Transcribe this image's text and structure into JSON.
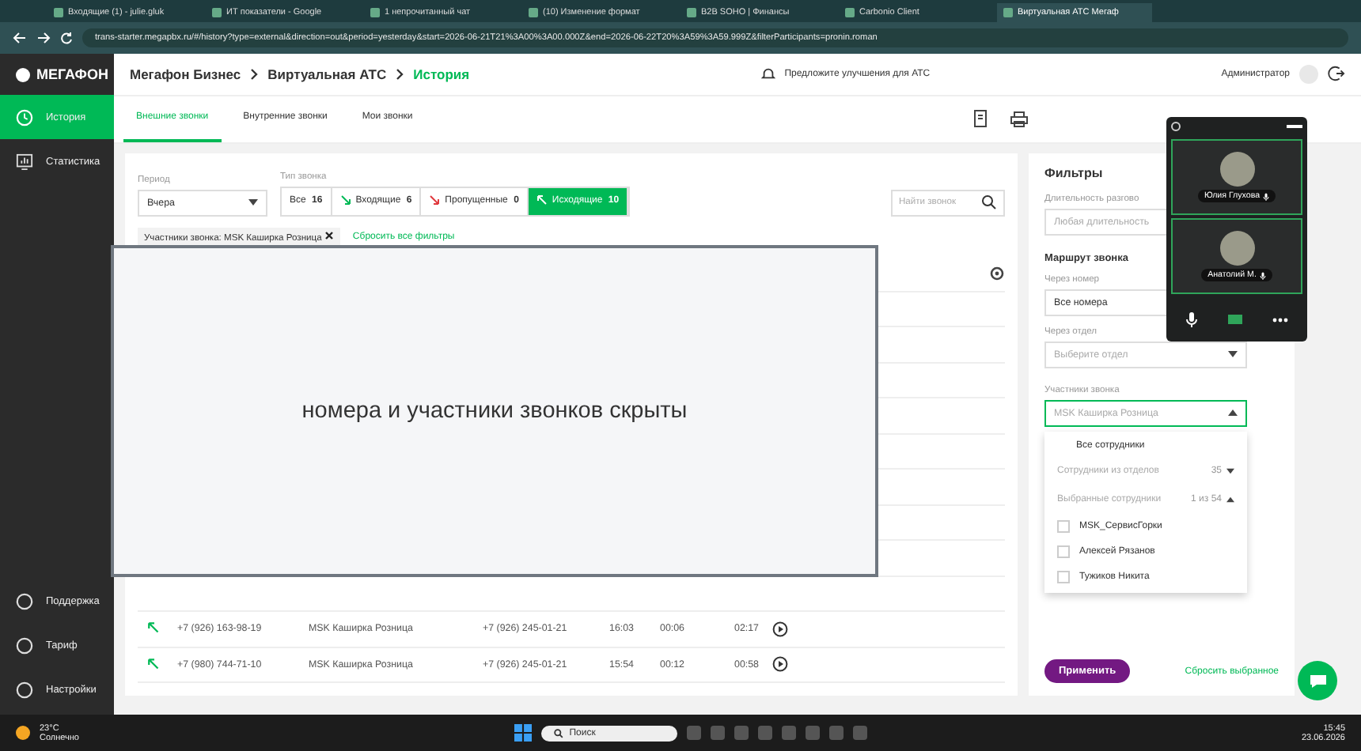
{
  "browser": {
    "tabs": [
      {
        "title": "Входящие (1) - julie.gluk",
        "selected": false
      },
      {
        "title": "ИТ показатели - Google",
        "selected": false
      },
      {
        "title": "1 непрочитанный чат",
        "selected": false
      },
      {
        "title": "(10) Изменение формат",
        "selected": false
      },
      {
        "title": "B2B SOHO | Финансы",
        "selected": false
      },
      {
        "title": "Carbonio Client",
        "selected": false
      },
      {
        "title": "Виртуальная АТС Мегаф",
        "selected": true
      }
    ],
    "url": "trans-starter.megapbx.ru/#/history?type=external&direction=out&period=yesterday&start=2026-06-21T21%3A00%3A00.000Z&end=2026-06-22T20%3A59%3A59.999Z&filterParticipants=pronin.roman"
  },
  "sidebar": {
    "logo": "МЕГАФОН",
    "items": [
      {
        "label": "История",
        "selected": true
      },
      {
        "label": "Статистика",
        "selected": false
      }
    ],
    "bottom_items": [
      "Поддержка",
      "Тариф",
      "Настройки"
    ]
  },
  "header": {
    "breadcrumbs": [
      "Мегафон Бизнес",
      "Виртуальная АТС",
      "История"
    ],
    "suggestion": "Предложите улучшения для АТС",
    "user": "Администратор"
  },
  "tabs": [
    {
      "label": "Внешние звонки",
      "selected": true
    },
    {
      "label": "Внутренние звонки",
      "selected": false
    },
    {
      "label": "Мои звонки",
      "selected": false
    }
  ],
  "filters": {
    "period_label": "Период",
    "period_value": "Вчера",
    "type_label": "Тип звонка",
    "types": [
      {
        "kind": "all",
        "label": "Все",
        "count": "16",
        "selected": false
      },
      {
        "kind": "incoming",
        "label": "Входящие",
        "count": "6",
        "selected": false
      },
      {
        "kind": "missed",
        "label": "Пропущенные",
        "count": "0",
        "selected": false
      },
      {
        "kind": "outgoing",
        "label": "Исходящие",
        "count": "10",
        "selected": true
      }
    ],
    "search_placeholder": "Найти звонок",
    "chip": "Участники звонка: MSK Каширка Розница",
    "reset": "Сбросить все фильтры"
  },
  "table": {
    "rows": [
      {
        "kind": "outgoing",
        "number": "+7 (926) 163-98-19",
        "participant": "MSK Каширка Розница",
        "line": "+7 (926) 245-01-21",
        "time": "16:03",
        "wait": "00:06",
        "duration": "02:17"
      },
      {
        "kind": "outgoing",
        "number": "+7 (980) 744-71-10",
        "participant": "MSK Каширка Розница",
        "line": "+7 (926) 245-01-21",
        "time": "15:54",
        "wait": "00:12",
        "duration": "00:58"
      }
    ]
  },
  "overlay": {
    "text": "номера и участники звонков скрыты"
  },
  "filter_panel": {
    "title": "Фильтры",
    "duration_label": "Длительность разгово",
    "duration_value": "Любая длительность",
    "route_title": "Маршрут звонка",
    "number_label": "Через номер",
    "number_value": "Все номера",
    "dept_label": "Через отдел",
    "dept_placeholder": "Выберите отдел",
    "participants_label": "Участники звонка",
    "participants_placeholder": "MSK Каширка Розница",
    "dropdown": {
      "all": "Все сотрудники",
      "groups": [
        {
          "label": "Сотрудники из отделов",
          "count": "35",
          "expanded": false
        },
        {
          "label": "Выбранные сотрудники",
          "count": "1 из 54",
          "expanded": true
        }
      ],
      "employees": [
        {
          "name": "MSK_СервисГорки",
          "checked": false
        },
        {
          "name": "Алексей Рязанов",
          "checked": false
        },
        {
          "name": "Тужиков Никита",
          "checked": false
        }
      ]
    },
    "apply": "Применить",
    "reset": "Сбросить выбранное"
  },
  "meeting": {
    "participants": [
      {
        "name": "Юлия Глухова"
      },
      {
        "name": "Анатолий М."
      }
    ]
  },
  "taskbar": {
    "temperature": "23°C",
    "weather": "Солнечно",
    "search_placeholder": "Поиск",
    "time": "15:45",
    "date": "23.06.2026"
  }
}
